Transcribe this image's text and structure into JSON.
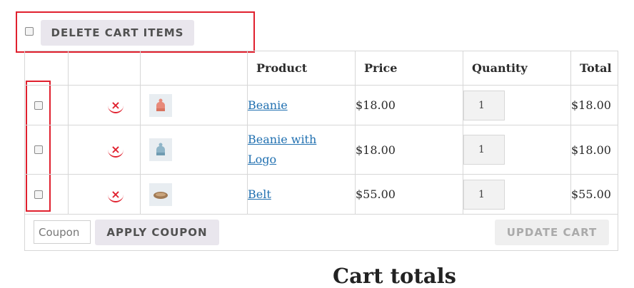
{
  "bulk": {
    "delete_label": "DELETE CART ITEMS"
  },
  "table": {
    "headers": {
      "product": "Product",
      "price": "Price",
      "quantity": "Quantity",
      "total": "Total"
    },
    "rows": [
      {
        "product": "Beanie",
        "price": "$18.00",
        "quantity": "1",
        "total": "$18.00",
        "thumb": "beanie-thumbnail"
      },
      {
        "product": "Beanie with Logo",
        "price": "$18.00",
        "quantity": "1",
        "total": "$18.00",
        "thumb": "beanie-logo-thumbnail"
      },
      {
        "product": "Belt",
        "price": "$55.00",
        "quantity": "1",
        "total": "$55.00",
        "thumb": "belt-thumbnail"
      }
    ],
    "remove_glyph": "×"
  },
  "actions": {
    "coupon_placeholder": "Coupon",
    "apply_label": "APPLY COUPON",
    "update_label": "UPDATE CART"
  },
  "totals": {
    "heading": "Cart totals"
  },
  "colors": {
    "highlight": "#e0202e",
    "link": "#2271b1",
    "button_bg": "#e9e6ed"
  }
}
